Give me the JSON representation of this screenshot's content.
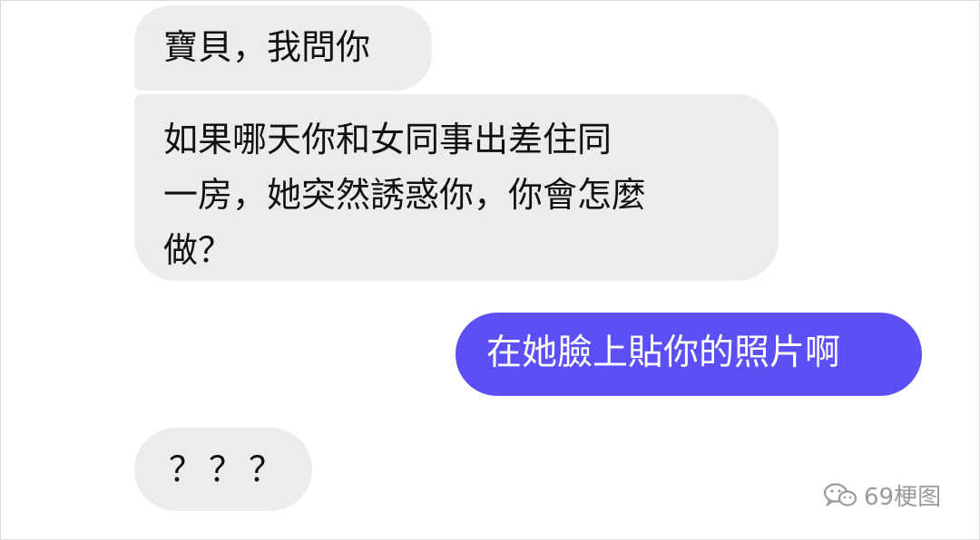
{
  "messages": [
    {
      "side": "incoming",
      "text": "寶貝，我問你"
    },
    {
      "side": "incoming",
      "text": "如果哪天你和女同事出差住同\n一房，她突然誘惑你，你會怎麼\n做？"
    },
    {
      "side": "outgoing",
      "text": "在她臉上貼你的照片啊"
    },
    {
      "side": "incoming",
      "text": "？？？"
    }
  ],
  "watermark": {
    "text": "69梗图",
    "icon": "wechat-icon"
  },
  "colors": {
    "incoming_bubble": "#ececec",
    "outgoing_bubble": "#5b4ff5",
    "outgoing_text": "#ffffff",
    "watermark": "#9a9a9a"
  }
}
